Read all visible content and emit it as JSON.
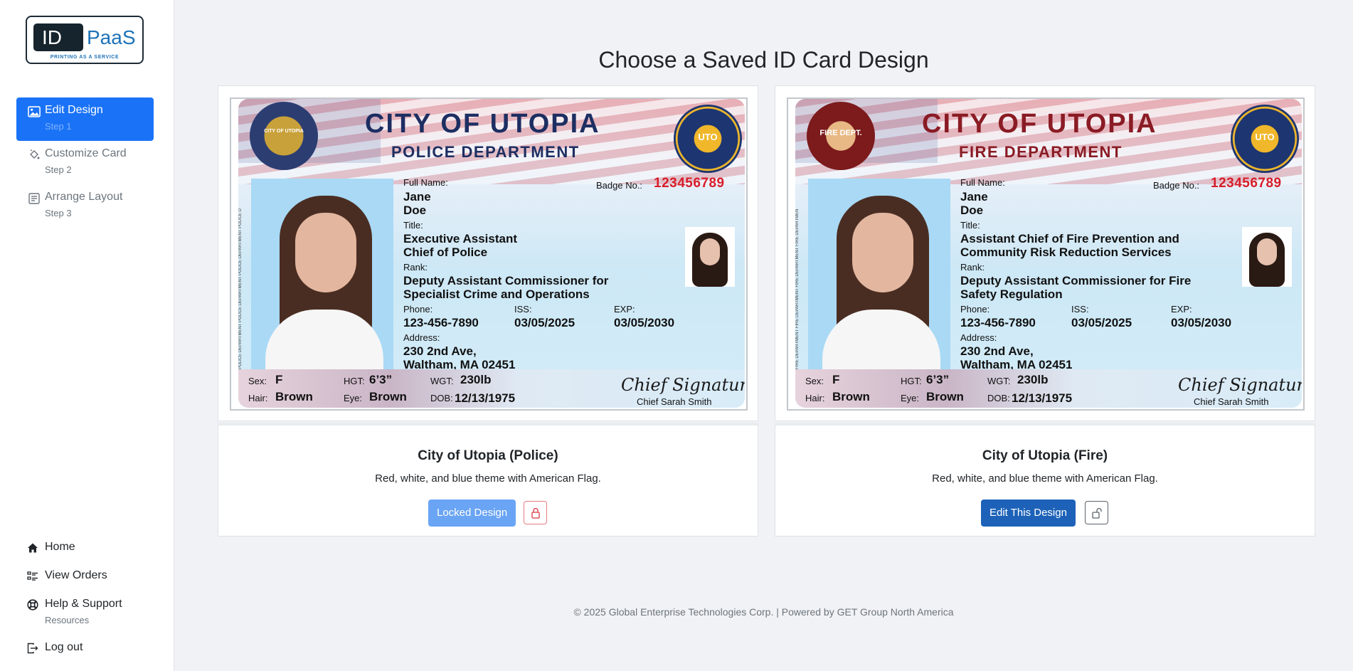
{
  "brand": {
    "logo_left": "ID",
    "logo_right": "PaaS",
    "tagline": "PRINTING AS A SERVICE"
  },
  "sidebar": {
    "steps": [
      {
        "label": "Edit Design",
        "sub": "Step 1",
        "icon": "image-icon",
        "active": true
      },
      {
        "label": "Customize Card",
        "sub": "Step 2",
        "icon": "paint-bucket-icon",
        "active": false
      },
      {
        "label": "Arrange Layout",
        "sub": "Step 3",
        "icon": "layout-icon",
        "active": false
      }
    ],
    "bottom": [
      {
        "label": "Home",
        "icon": "home-icon"
      },
      {
        "label": "View Orders",
        "icon": "list-icon"
      },
      {
        "label": "Help & Support",
        "sub": "Resources",
        "icon": "life-ring-icon"
      },
      {
        "label": "Log out",
        "icon": "logout-icon"
      }
    ]
  },
  "main": {
    "title": "Choose a Saved ID Card Design",
    "cards": [
      {
        "name": "City of Utopia (Police)",
        "description": "Red, white, and blue theme with American Flag.",
        "button": "Locked Design",
        "locked": true,
        "preview": {
          "city": "CITY OF UTOPIA",
          "department": "POLICE DEPARTMENT",
          "side_text": "POLICE DEPARTMENT POLICE DEPARTMENT POLICE DEPARTMENT POLICE D",
          "seal_left": "CITY OF UTOPIA",
          "seal_right": "UTO",
          "full_name_label": "Full Name:",
          "name_line1": "Jane",
          "name_line2": "Doe",
          "badge_label": "Badge No.:",
          "badge_no": "123456789",
          "title_label": "Title:",
          "title_line1": "Executive Assistant",
          "title_line2": "Chief of Police",
          "rank_label": "Rank:",
          "rank_line1": "Deputy Assistant Commissioner for",
          "rank_line2": "Specialist Crime and Operations",
          "phone_label": "Phone:",
          "phone": "123-456-7890",
          "iss_label": "ISS:",
          "iss": "03/05/2025",
          "exp_label": "EXP:",
          "exp": "03/05/2030",
          "address_label": "Address:",
          "address_line1": "230 2nd Ave,",
          "address_line2": "Waltham, MA 02451",
          "sex_label": "Sex:",
          "sex": "F",
          "hgt_label": "HGT:",
          "hgt": "6’3”",
          "wgt_label": "WGT:",
          "wgt": "230lb",
          "hair_label": "Hair:",
          "hair": "Brown",
          "eye_label": "Eye:",
          "eye": "Brown",
          "dob_label": "DOB:",
          "dob": "12/13/1975",
          "signature": "Chief Signature",
          "signer": "Chief Sarah Smith"
        }
      },
      {
        "name": "City of Utopia (Fire)",
        "description": "Red, white, and blue theme with American Flag.",
        "button": "Edit This Design",
        "locked": false,
        "preview": {
          "city": "CITY OF UTOPIA",
          "department": "FIRE DEPARTMENT",
          "side_text": "FIRE DEPARTMENT FIRE DEPARTMENT FIRE DEPARTMENT FIRE DEPARTMEN",
          "seal_left": "FIRE DEPT.",
          "seal_right": "UTO",
          "full_name_label": "Full Name:",
          "name_line1": "Jane",
          "name_line2": "Doe",
          "badge_label": "Badge No.:",
          "badge_no": "123456789",
          "title_label": "Title:",
          "title_line1": "Assistant Chief of Fire Prevention and",
          "title_line2": "Community Risk Reduction Services",
          "rank_label": "Rank:",
          "rank_line1": "Deputy Assistant Commissioner for Fire",
          "rank_line2": "Safety Regulation",
          "phone_label": "Phone:",
          "phone": "123-456-7890",
          "iss_label": "ISS:",
          "iss": "03/05/2025",
          "exp_label": "EXP:",
          "exp": "03/05/2030",
          "address_label": "Address:",
          "address_line1": "230 2nd Ave,",
          "address_line2": "Waltham, MA 02451",
          "sex_label": "Sex:",
          "sex": "F",
          "hgt_label": "HGT:",
          "hgt": "6’3”",
          "wgt_label": "WGT:",
          "wgt": "230lb",
          "hair_label": "Hair:",
          "hair": "Brown",
          "eye_label": "Eye:",
          "eye": "Brown",
          "dob_label": "DOB:",
          "dob": "12/13/1975",
          "signature": "Chief Signature",
          "signer": "Chief Sarah Smith"
        }
      }
    ]
  },
  "footer": {
    "text": "© 2025 Global Enterprise Technologies Corp. | Powered by GET Group North America"
  },
  "colors": {
    "primary": "#1a73f7",
    "edit_button": "#1d62b8",
    "locked_button": "#6aa4f4",
    "badge_red": "#d71d2a"
  }
}
